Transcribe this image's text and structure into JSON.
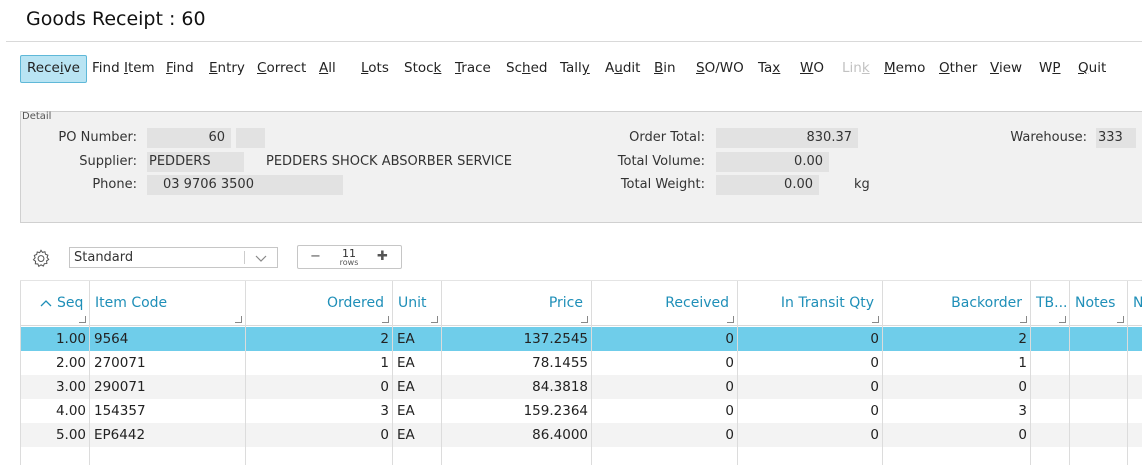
{
  "title": "Goods Receipt : 60",
  "toolbar": [
    {
      "pre": "Rece",
      "u": "i",
      "post": "ve",
      "state": "active"
    },
    {
      "pre": "Find ",
      "u": "I",
      "post": "tem",
      "state": "normal"
    },
    {
      "pre": "",
      "u": "F",
      "post": "ind",
      "state": "normal"
    },
    {
      "pre": "",
      "u": "E",
      "post": "ntry",
      "state": "normal"
    },
    {
      "pre": "",
      "u": "C",
      "post": "orrect",
      "state": "normal"
    },
    {
      "pre": "",
      "u": "A",
      "post": "ll",
      "state": "normal"
    },
    {
      "pre": "",
      "u": "L",
      "post": "ots",
      "state": "normal"
    },
    {
      "pre": "Stoc",
      "u": "k",
      "post": "",
      "state": "normal"
    },
    {
      "pre": "",
      "u": "T",
      "post": "race",
      "state": "normal"
    },
    {
      "pre": "Sc",
      "u": "h",
      "post": "ed",
      "state": "normal"
    },
    {
      "pre": "Tall",
      "u": "y",
      "post": "",
      "state": "normal"
    },
    {
      "pre": "A",
      "u": "u",
      "post": "dit",
      "state": "normal"
    },
    {
      "pre": "",
      "u": "B",
      "post": "in",
      "state": "normal"
    },
    {
      "pre": "",
      "u": "S",
      "post": "O/WO",
      "state": "normal"
    },
    {
      "pre": "Ta",
      "u": "x",
      "post": "",
      "state": "normal"
    },
    {
      "pre": "",
      "u": "W",
      "post": "O",
      "state": "normal"
    },
    {
      "pre": "Lin",
      "u": "k",
      "post": "",
      "state": "disabled"
    },
    {
      "pre": "",
      "u": "M",
      "post": "emo",
      "state": "normal"
    },
    {
      "pre": "",
      "u": "O",
      "post": "ther",
      "state": "normal"
    },
    {
      "pre": "",
      "u": "V",
      "post": "iew",
      "state": "normal"
    },
    {
      "pre": "W",
      "u": "P",
      "post": "",
      "state": "normal"
    },
    {
      "pre": "",
      "u": "Q",
      "post": "uit",
      "state": "normal"
    }
  ],
  "detail": {
    "caption": "Detail",
    "po_label": "PO Number:",
    "po_value": "60",
    "supplier_label": "Supplier:",
    "supplier_code": "PEDDERS",
    "supplier_name": "PEDDERS SHOCK ABSORBER SERVICE",
    "phone_label": "Phone:",
    "phone_value": "03 9706 3500",
    "order_total_label": "Order Total:",
    "order_total_value": "830.37",
    "total_volume_label": "Total Volume:",
    "total_volume_value": "0.00",
    "total_weight_label": "Total Weight:",
    "total_weight_value": "0.00",
    "weight_unit": "kg",
    "warehouse_label": "Warehouse:",
    "warehouse_value": "333"
  },
  "grid_controls": {
    "view_value": "Standard",
    "rows_count": "11",
    "rows_label": "rows"
  },
  "columns": [
    "Seq",
    "Item Code",
    "Ordered",
    "Unit",
    "Price",
    "Received",
    "In Transit Qty",
    "Backorder",
    "TB...",
    "Notes",
    "N"
  ],
  "rows": [
    {
      "seq": "1.00",
      "item": "9564",
      "ordered": "2",
      "unit": "EA",
      "price": "137.2545",
      "received": "0",
      "transit": "0",
      "backorder": "2",
      "selected": true
    },
    {
      "seq": "2.00",
      "item": "270071",
      "ordered": "1",
      "unit": "EA",
      "price": "78.1455",
      "received": "0",
      "transit": "0",
      "backorder": "1",
      "selected": false
    },
    {
      "seq": "3.00",
      "item": "290071",
      "ordered": "0",
      "unit": "EA",
      "price": "84.3818",
      "received": "0",
      "transit": "0",
      "backorder": "0",
      "selected": false
    },
    {
      "seq": "4.00",
      "item": "154357",
      "ordered": "3",
      "unit": "EA",
      "price": "159.2364",
      "received": "0",
      "transit": "0",
      "backorder": "3",
      "selected": false
    },
    {
      "seq": "5.00",
      "item": "EP6442",
      "ordered": "0",
      "unit": "EA",
      "price": "86.4000",
      "received": "0",
      "transit": "0",
      "backorder": "0",
      "selected": false
    }
  ],
  "colors": {
    "accent": "#1f8fb8",
    "selected_row": "#6fcdea",
    "alt_row": "#f3f3f3",
    "active_button": "#b9e4f3"
  },
  "icons": {
    "settings": "gear-icon",
    "sort": "sort-asc-icon",
    "dropdown": "chevron-down-icon",
    "minus": "minus-icon",
    "plus": "plus-icon"
  }
}
